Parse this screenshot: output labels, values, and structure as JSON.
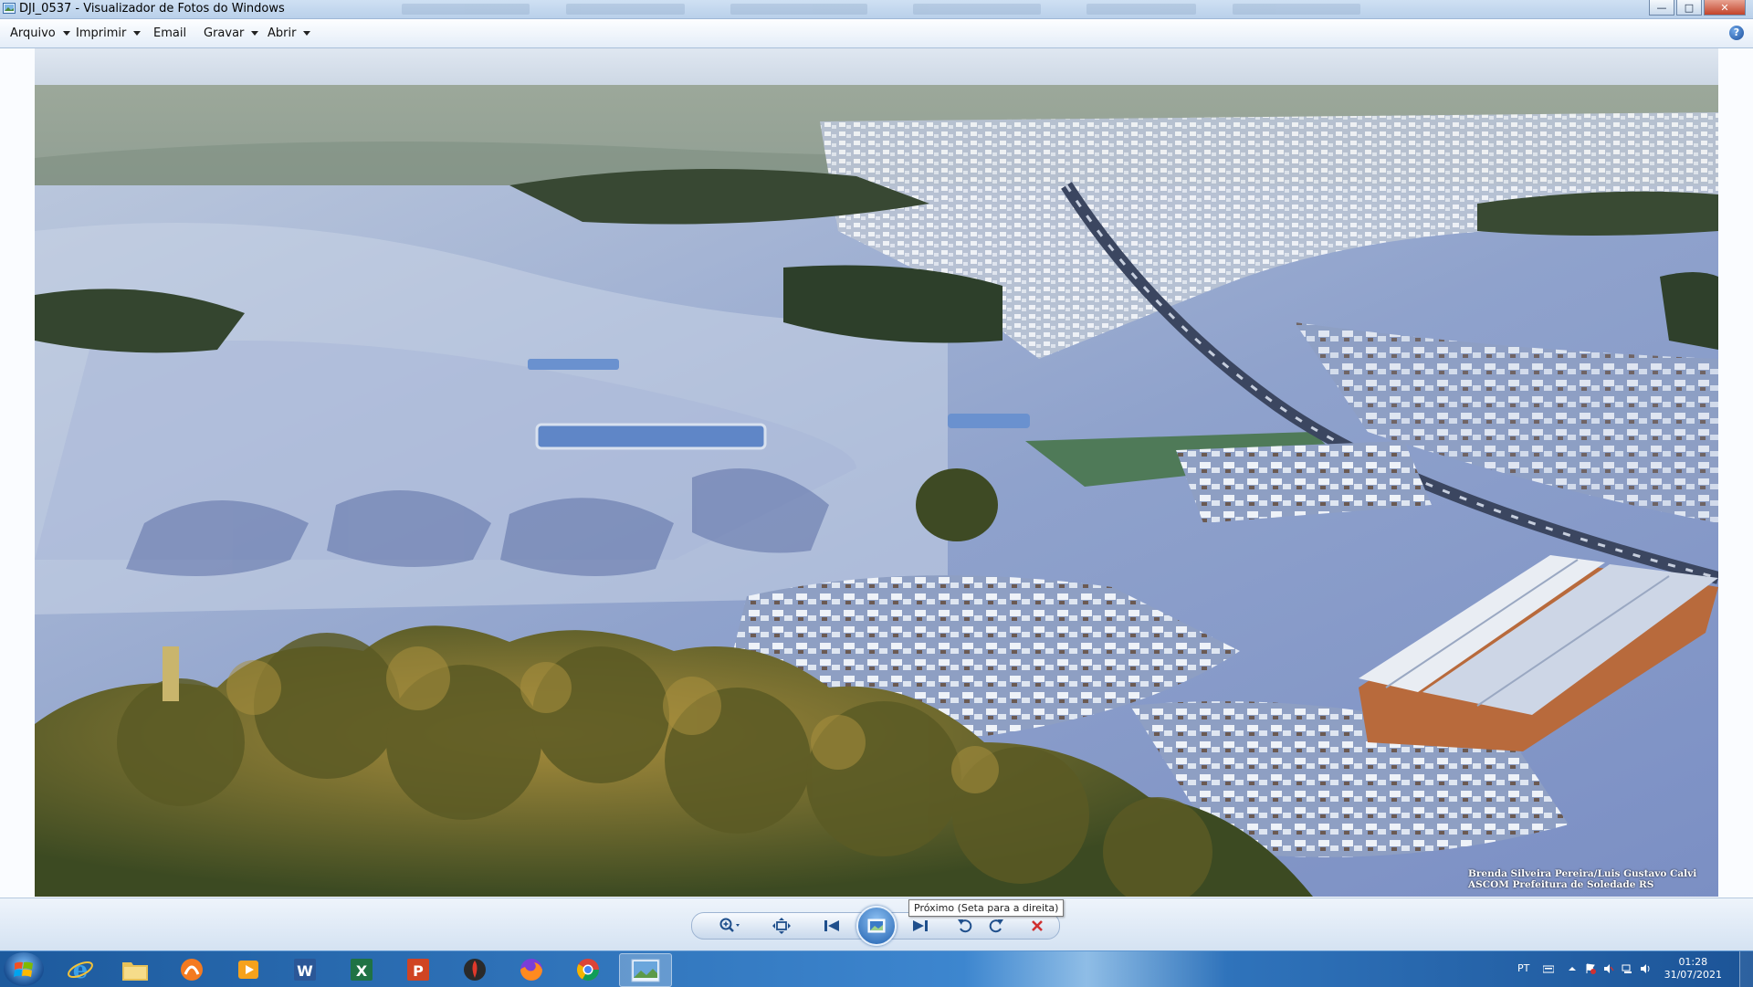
{
  "window": {
    "title": "DJI_0537 - Visualizador de Fotos do Windows",
    "controls": {
      "minimize": "—",
      "maximize": "□",
      "close": "✕"
    }
  },
  "menubar": {
    "items": [
      {
        "label": "Arquivo",
        "has_dropdown": true
      },
      {
        "label": "Imprimir",
        "has_dropdown": true
      },
      {
        "label": "Email",
        "has_dropdown": false
      },
      {
        "label": "Gravar",
        "has_dropdown": true
      },
      {
        "label": "Abrir",
        "has_dropdown": true
      }
    ],
    "help_icon": "help-icon"
  },
  "photo": {
    "subject": "aerial-town-frost",
    "caption_line1": "Brenda Silveira Pereira/Luis Gustavo Calvi",
    "caption_line2": "ASCOM Prefeitura de Soledade RS"
  },
  "controls": {
    "tooltip": "Próximo (Seta para a direita)",
    "buttons": [
      "zoom-icon",
      "actual-size-icon",
      "previous-icon",
      "slideshow-icon",
      "next-icon",
      "rotate-left-icon",
      "rotate-right-icon",
      "delete-icon"
    ]
  },
  "taskbar": {
    "apps": [
      "internet-explorer-icon",
      "file-explorer-icon",
      "avast-icon",
      "media-player-icon",
      "word-icon",
      "excel-icon",
      "powerpoint-icon",
      "torch-icon",
      "firefox-icon",
      "chrome-icon",
      "photo-viewer-icon"
    ],
    "active_app": "photo-viewer-icon",
    "tray": {
      "language": "PT",
      "time": "01:28",
      "date": "31/07/2021"
    }
  },
  "colors": {
    "titlebar": "#c4d8ef",
    "taskbar": "#2b6bb3",
    "slideshow": "#1e5fae",
    "delete": "#d03030"
  }
}
